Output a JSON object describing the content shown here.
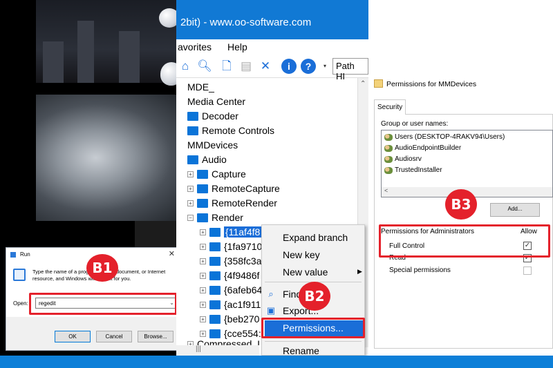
{
  "run_dialog": {
    "title": "Run",
    "description": "Type the name of a program, folder, document, or Internet resource, and Windows will open it for you.",
    "open_label": "Open:",
    "open_value": "regedit",
    "ok_label": "OK",
    "cancel_label": "Cancel",
    "browse_label": "Browse...",
    "badge": "B1"
  },
  "regedit": {
    "title": "2bit) - www.oo-software.com",
    "menu": [
      "avorites",
      "Help"
    ],
    "path_label": "Path",
    "path_value": "HI",
    "tree": [
      "MDE_",
      "Media Center",
      "Decoder",
      "Remote Controls",
      "MMDevices",
      "Audio",
      "Capture",
      "RemoteCapture",
      "RemoteRender",
      "Render",
      "{11af4f8",
      "{1fa9710",
      "{358fc3a",
      "{4f9486f",
      "{6afeb64",
      "{ac1f911",
      "{beb270",
      "{cce554:",
      "Compressed_I"
    ]
  },
  "context_menu": {
    "items": [
      "Expand branch",
      "New key",
      "New value",
      "Find...",
      "Export...",
      "Permissions...",
      "Rename"
    ],
    "badge": "B2"
  },
  "permissions": {
    "title": "Permissions for MMDevices",
    "tab": "Security",
    "group_label": "Group or user names:",
    "users": [
      "Users (DESKTOP-4RAKV94\\Users)",
      "AudioEndpointBuilder",
      "Audiosrv",
      "TrustedInstaller"
    ],
    "add_label": "Add...",
    "perm_header": "Permissions for Administrators",
    "allow_header": "Allow",
    "rows": [
      {
        "label": "Full Control",
        "checked": true
      },
      {
        "label": "Read",
        "checked": true
      },
      {
        "label": "Special permissions",
        "checked": false
      }
    ],
    "badge": "B3"
  },
  "colors": {
    "accent": "#1179d4",
    "highlight": "#e4212b",
    "selection": "#1a6ed8"
  }
}
